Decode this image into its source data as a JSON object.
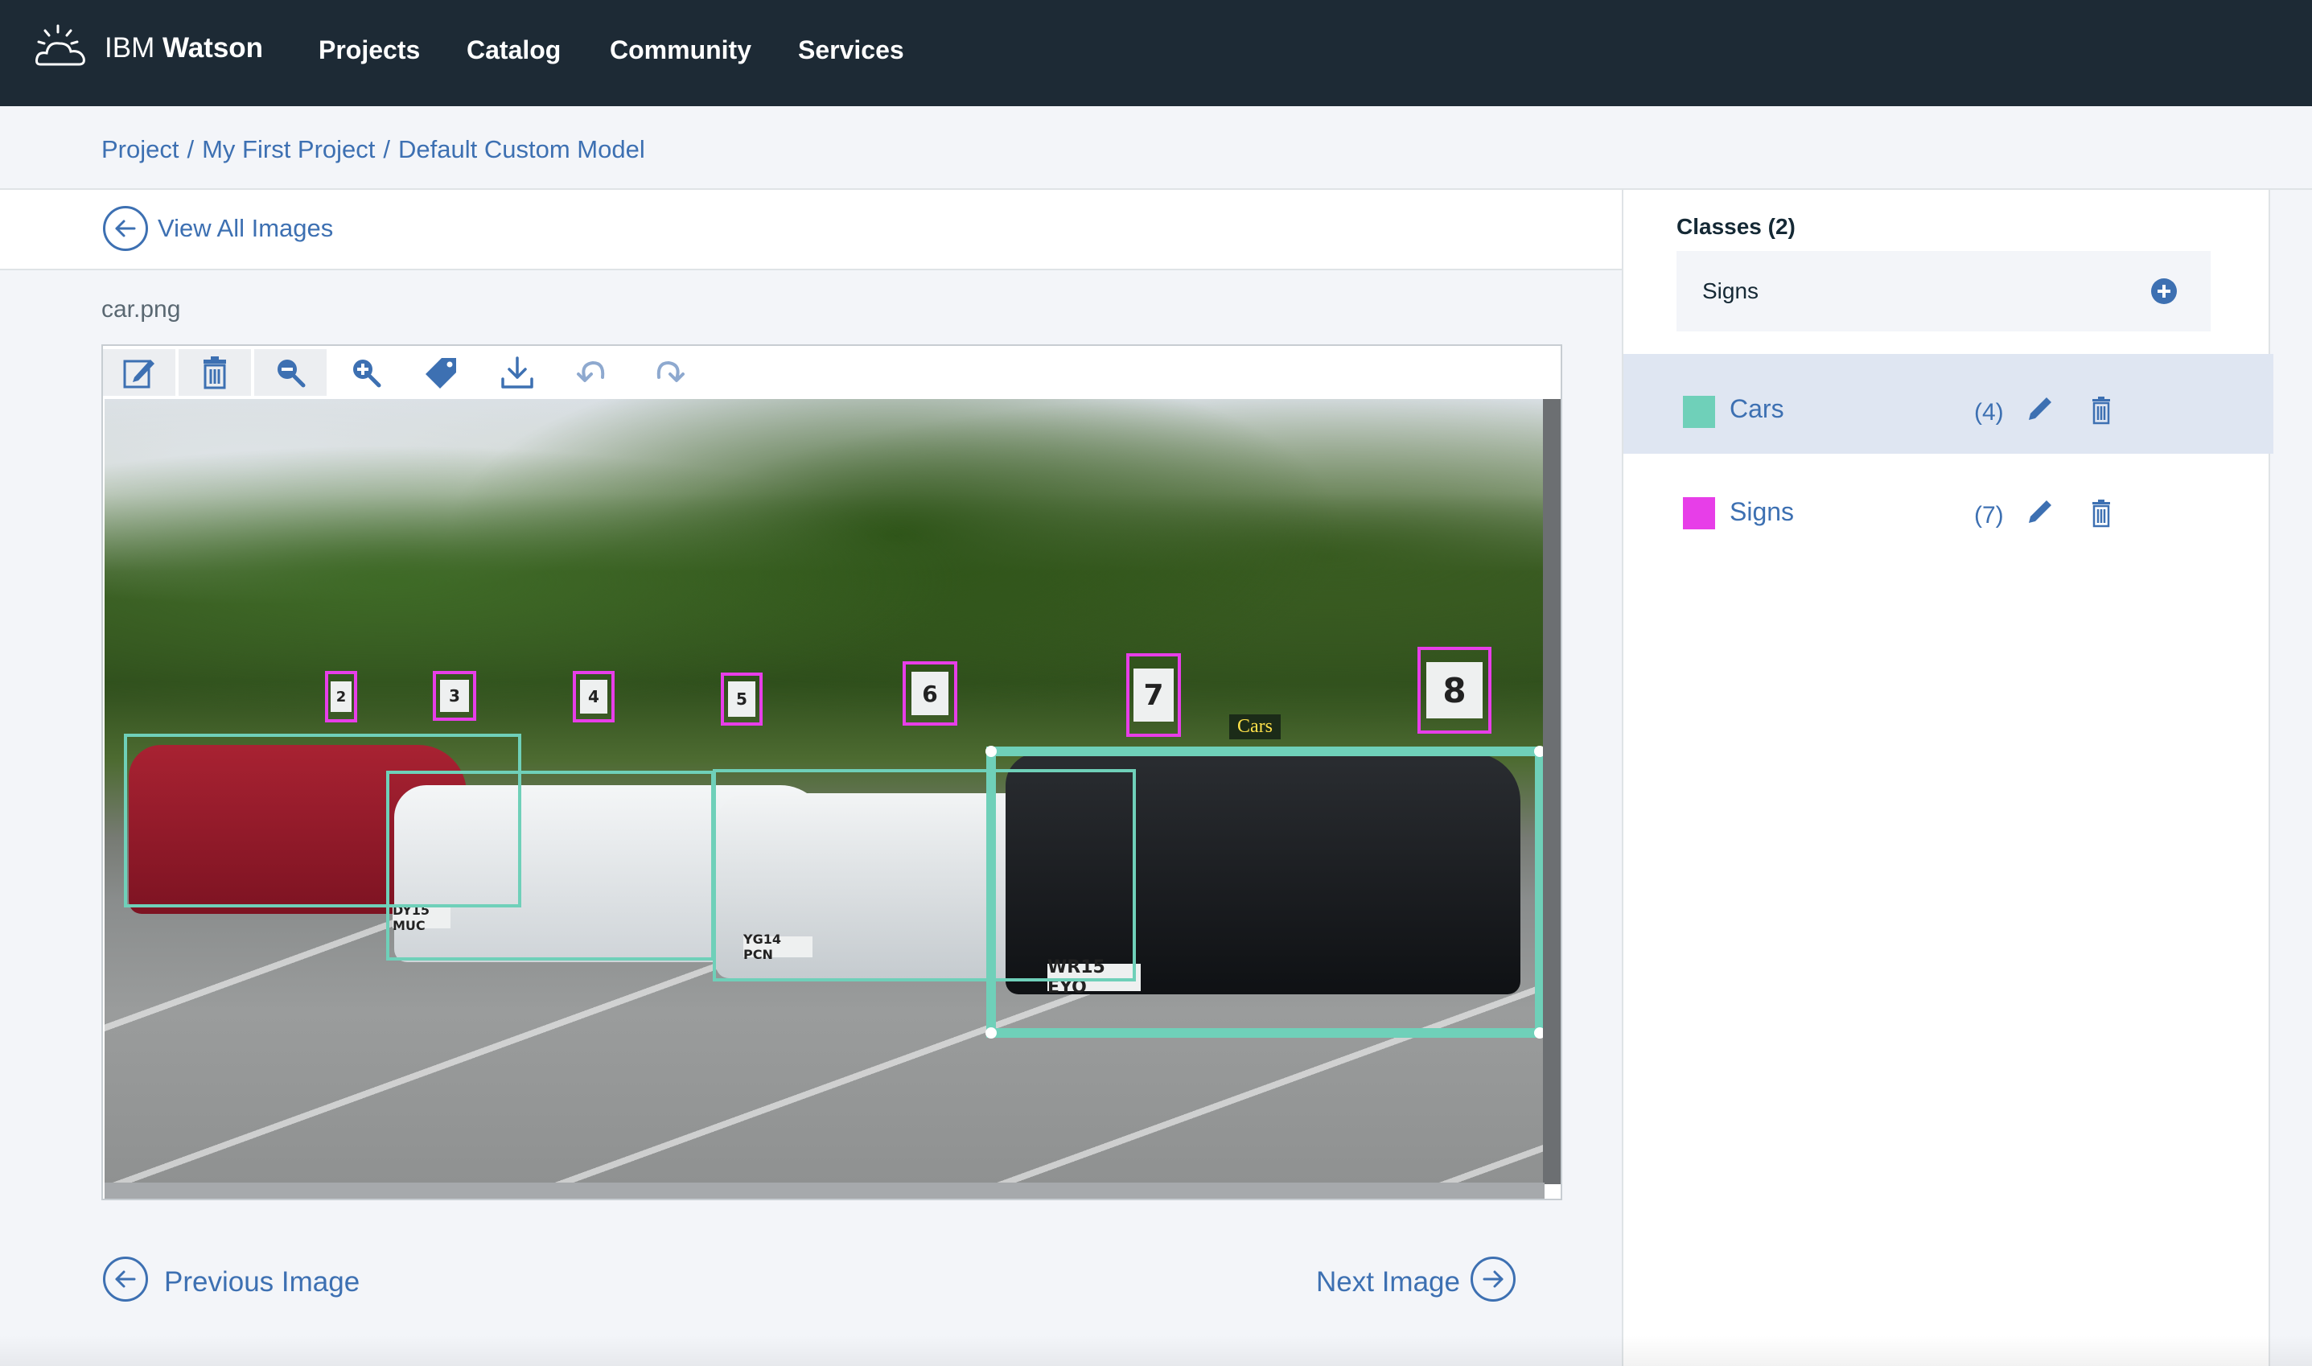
{
  "header": {
    "brand_prefix": "IBM",
    "brand_name": "Watson",
    "nav": [
      "Projects",
      "Catalog",
      "Community",
      "Services"
    ]
  },
  "breadcrumb": {
    "items": [
      "Project",
      "My First Project",
      "Default Custom Model"
    ],
    "separator": "/"
  },
  "view_all_label": "View All Images",
  "image": {
    "filename": "car.png",
    "toolbar": [
      {
        "name": "edit-icon",
        "active": true
      },
      {
        "name": "trash-icon",
        "active": true
      },
      {
        "name": "zoom-out-icon",
        "active": true
      },
      {
        "name": "zoom-in-icon",
        "active": false
      },
      {
        "name": "tag-icon",
        "active": false
      },
      {
        "name": "download-icon",
        "active": false
      },
      {
        "name": "undo-icon",
        "active": false
      },
      {
        "name": "redo-icon",
        "active": false
      }
    ],
    "selected_box_label": "Cars",
    "sign_numbers": [
      "2",
      "3",
      "4",
      "5",
      "6",
      "7",
      "8"
    ],
    "plates": [
      "DY15 MUC",
      "YG14 PCN",
      "WR15 EYO"
    ]
  },
  "pagination": {
    "previous_label": "Previous Image",
    "next_label": "Next Image"
  },
  "classes_panel": {
    "title": "Classes (2)",
    "input_value": "Signs",
    "classes": [
      {
        "name": "Cars",
        "count": "(4)",
        "color": "#6fd0b9",
        "selected": true
      },
      {
        "name": "Signs",
        "count": "(7)",
        "color": "#e73ee8",
        "selected": false
      }
    ]
  },
  "colors": {
    "accent": "#3d70b2",
    "topbar": "#1d2a35",
    "car_box": "#6fd0b9",
    "sign_box": "#e73ee8"
  }
}
